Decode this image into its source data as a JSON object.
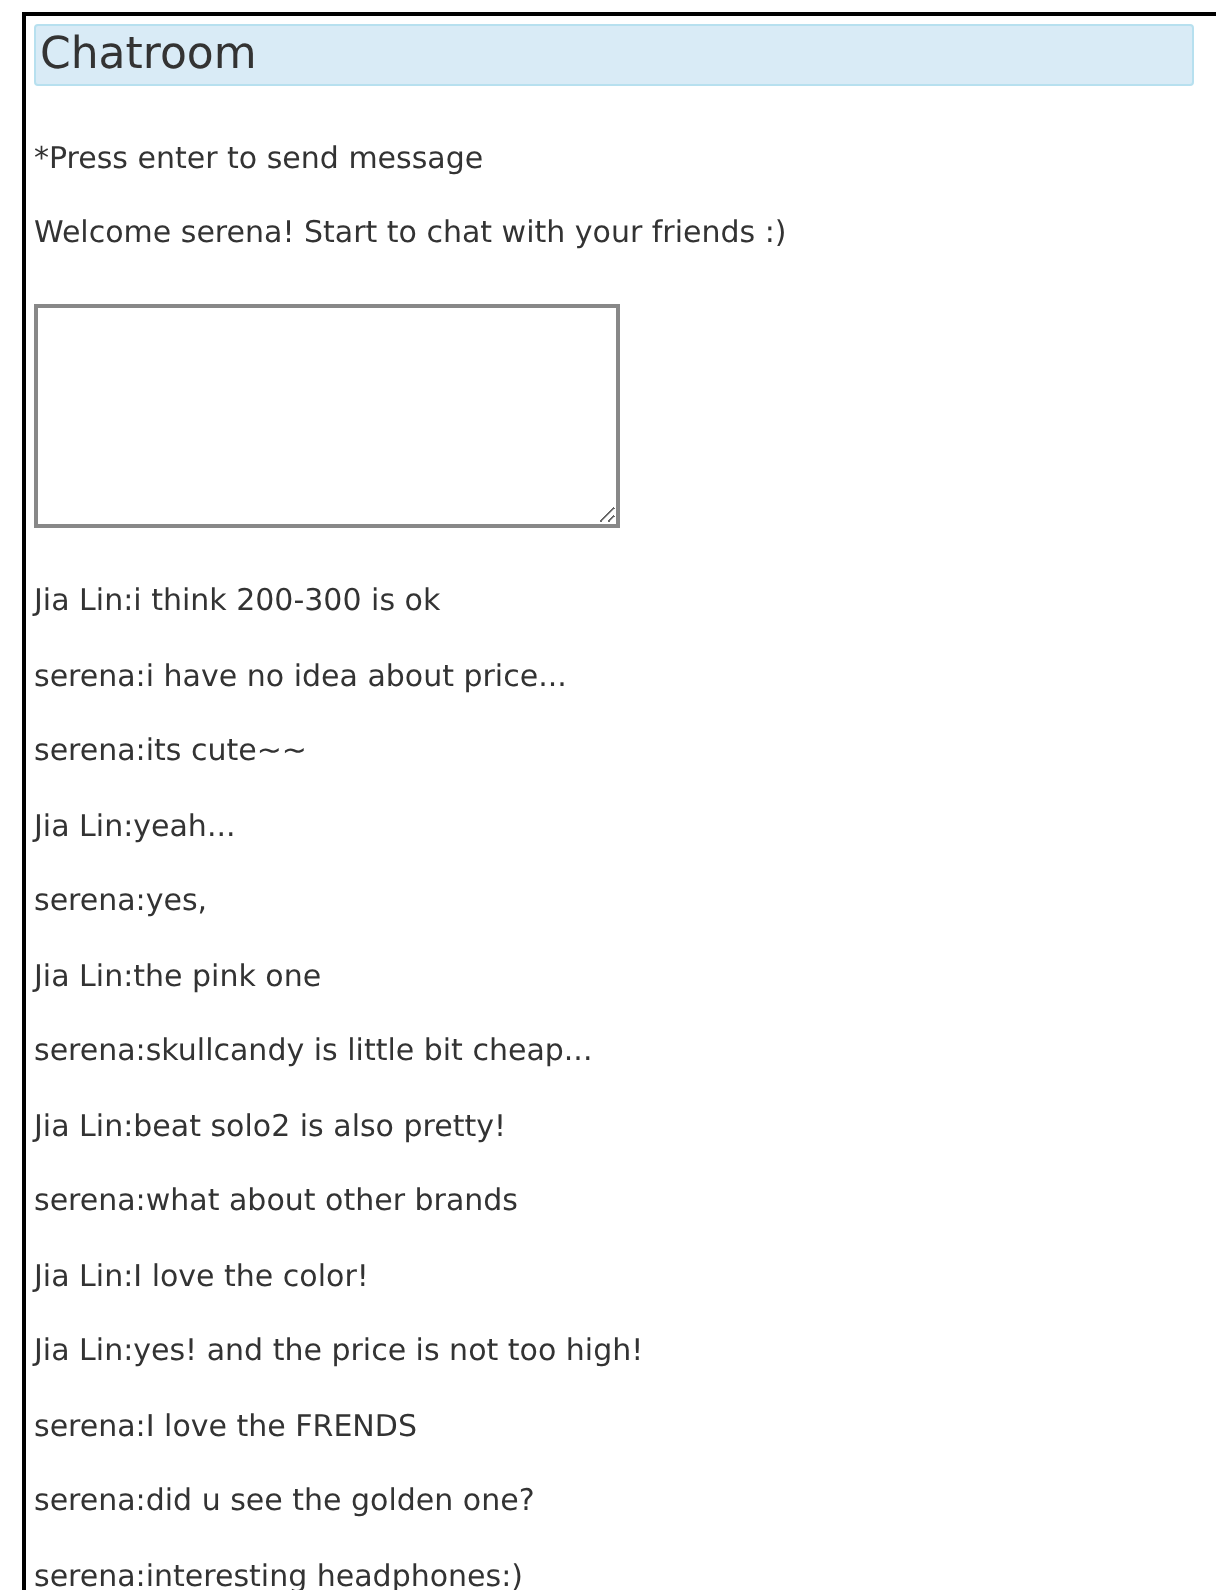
{
  "header": {
    "title": "Chatroom"
  },
  "hint": "*Press enter to send message",
  "welcome": "Welcome serena! Start to chat with your friends :)",
  "messages": [
    "Jia Lin:i think 200-300 is ok",
    "serena:i have no idea about price...",
    "serena:its cute~~",
    "Jia Lin:yeah...",
    "serena:yes,",
    "Jia Lin:the pink one",
    "serena:skullcandy is little bit cheap...",
    "Jia Lin:beat solo2 is also pretty!",
    "serena:what about other brands",
    "Jia Lin:I love the color!",
    "Jia Lin:yes! and the price is not too high!",
    "serena:I love the FRENDS",
    "serena:did u see the golden one?",
    "serena:interesting headphones:)"
  ]
}
